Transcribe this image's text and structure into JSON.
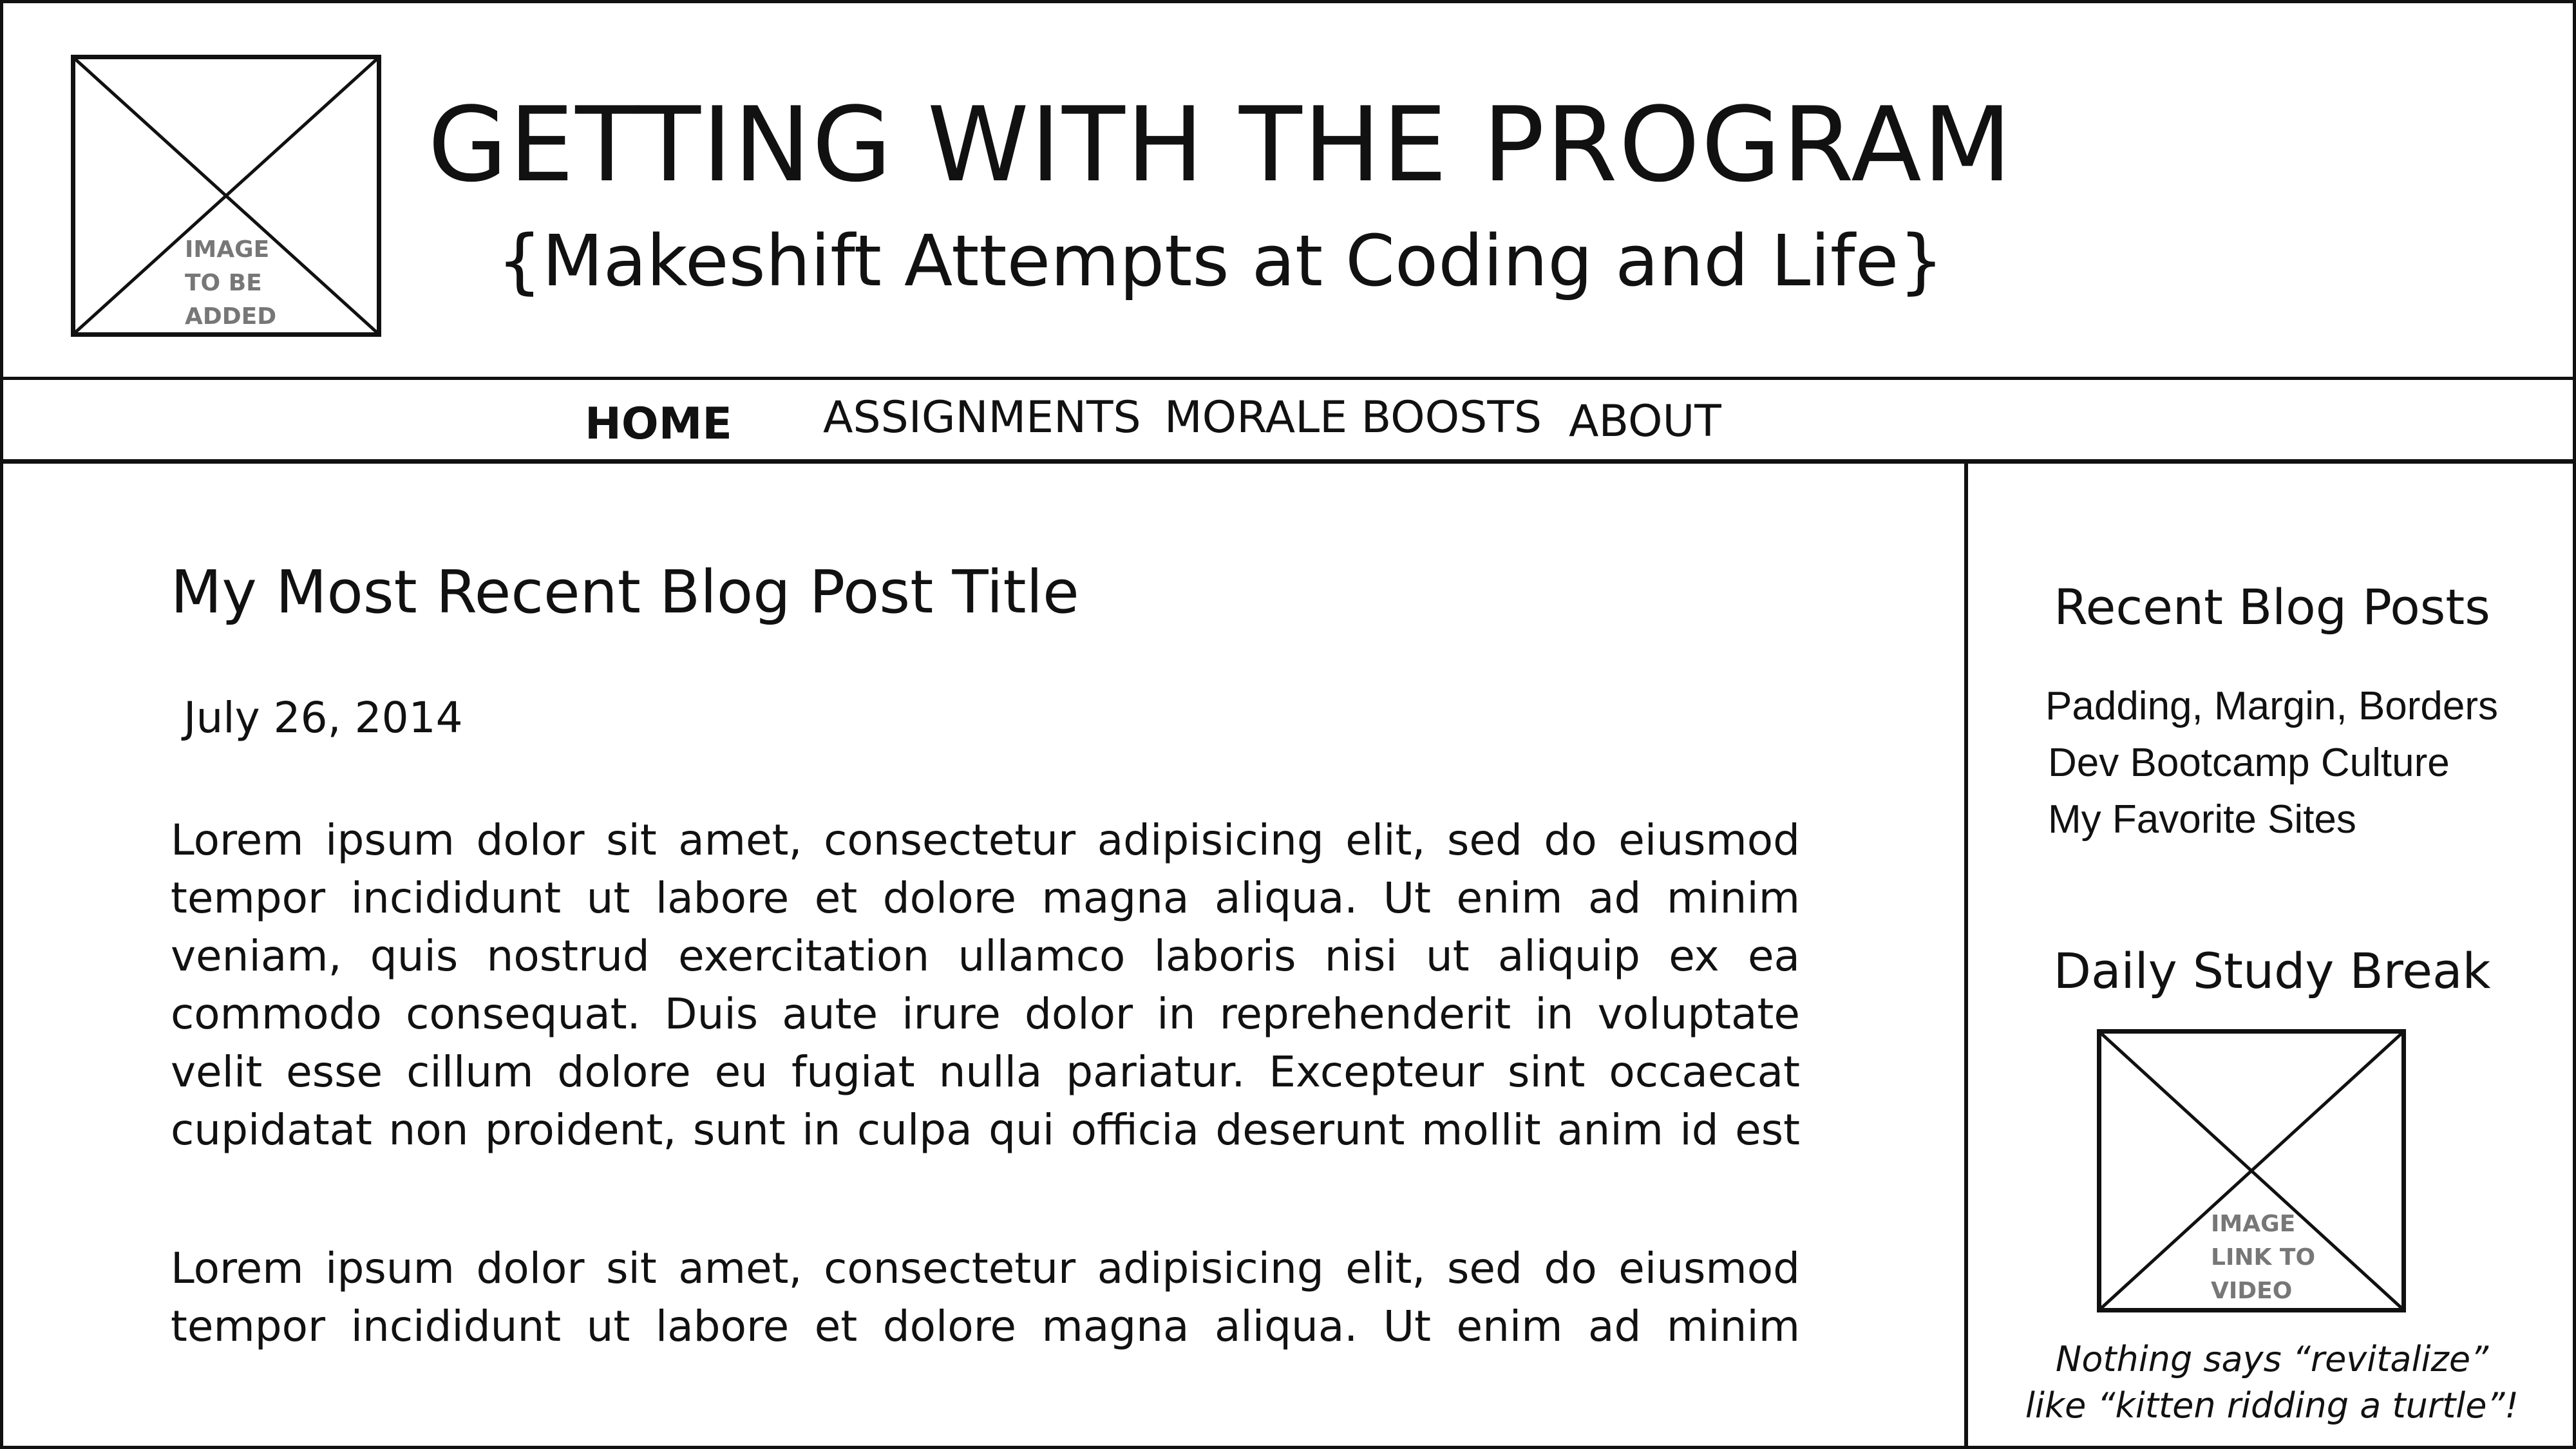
{
  "header": {
    "logo_placeholder_text": "IMAGE\nTO BE\nADDED",
    "title": "GETTING WITH THE PROGRAM",
    "tagline": "{Makeshift Attempts at Coding and Life}"
  },
  "nav": {
    "items": [
      {
        "label": "HOME",
        "active": true
      },
      {
        "label": "ASSIGNMENTS",
        "active": false
      },
      {
        "label": "MORALE BOOSTS",
        "active": false
      },
      {
        "label": "ABOUT",
        "active": false
      }
    ]
  },
  "post": {
    "title": "My Most Recent Blog Post Title",
    "date": "July 26, 2014",
    "paragraphs": [
      "Lorem ipsum dolor sit amet, consectetur adipisicing elit, sed do eiusmod tempor incididunt ut labore et dolore magna aliqua. Ut enim ad minim veniam, quis nostrud exercitation ullamco laboris nisi ut aliquip ex ea commodo consequat. Duis aute irure dolor in reprehenderit in voluptate velit esse cillum dolore eu fugiat nulla pariatur. Excepteur sint occaecat cupidatat non proident, sunt in culpa qui officia deserunt mollit anim id est laborum.",
      "Lorem ipsum dolor sit amet, consectetur adipisicing elit, sed do eiusmod tempor incididunt ut labore et dolore magna aliqua. Ut enim ad minim veniam, quis nostrud"
    ]
  },
  "sidebar": {
    "recent_heading": "Recent Blog Posts",
    "recent_posts": [
      "Padding, Margin, Borders",
      "Dev Bootcamp Culture",
      "My Favorite Sites"
    ],
    "study_heading": "Daily Study Break",
    "video_placeholder_text": "IMAGE\nLINK TO\nVIDEO",
    "caption": "Nothing says “revitalize”\nlike “kitten ridding a turtle”!"
  }
}
